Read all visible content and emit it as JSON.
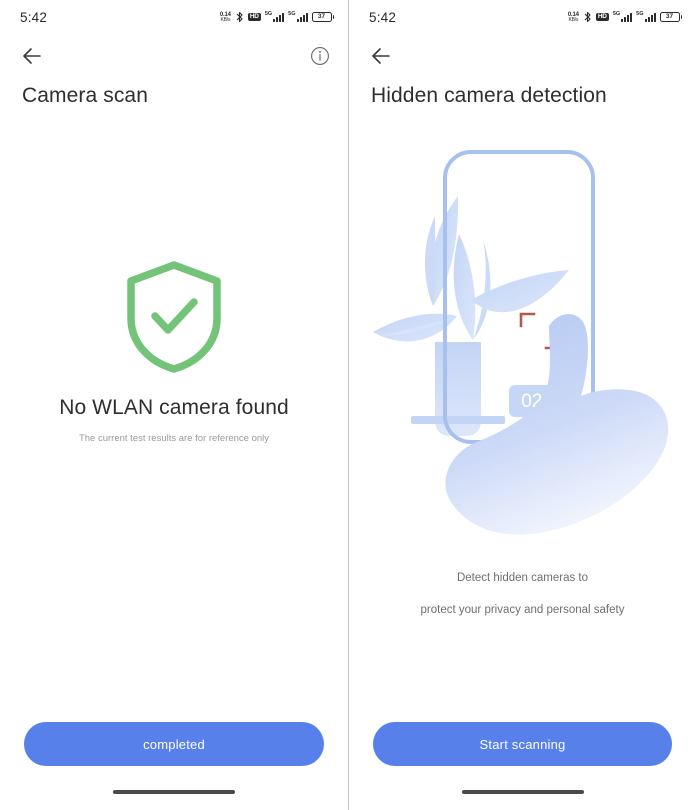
{
  "theme": {
    "accent_blue": "#5780ea",
    "shield_green": "#73c378",
    "illustration_blue": "#b9cdf5",
    "scan_bracket": "#b05c4a",
    "divider": "#c9c9c9",
    "title_color": "#2e2e2e",
    "muted_color": "#9a9a9a"
  },
  "status_bar": {
    "time": "5:42",
    "net_speed_value": "0.14",
    "net_speed_unit": "KB/s",
    "bluetooth_icon": "bluetooth-icon",
    "hd_label": "HD",
    "sim1_label": "5G",
    "sim2_label": "5G",
    "battery_percent": "37"
  },
  "left_screen": {
    "back_icon": "back-arrow-icon",
    "info_icon": "info-icon",
    "title": "Camera scan",
    "shield_icon": "shield-check-icon",
    "result_title": "No WLAN camera found",
    "result_subtitle": "The current test results are for reference only",
    "cta_label": "completed"
  },
  "right_screen": {
    "back_icon": "back-arrow-icon",
    "title": "Hidden camera detection",
    "illustration": {
      "name": "hand-holding-phone-scanning-plant-illustration",
      "scan_bracket_icon": "scan-bracket-icon",
      "timer_label": "02:36"
    },
    "description_line1": "Detect hidden cameras to",
    "description_line2": "protect your privacy and personal safety",
    "cta_label": "Start scanning"
  }
}
